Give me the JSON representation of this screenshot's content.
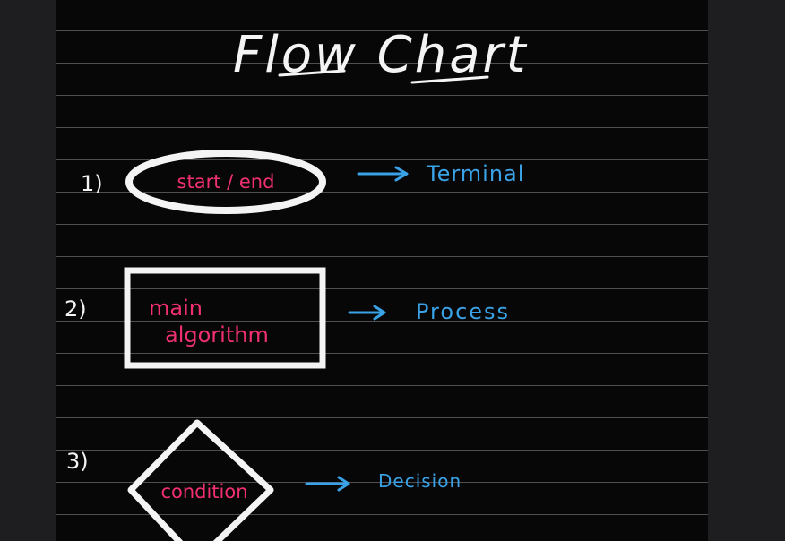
{
  "title": "Flow Chart",
  "colors": {
    "chalk": "#f4f4f4",
    "pink": "#f0306f",
    "blue": "#3aa2e6",
    "paper": "#070708"
  },
  "items": [
    {
      "number": "1)",
      "shape": "ellipse",
      "label": "start / end",
      "name": "Terminal"
    },
    {
      "number": "2)",
      "shape": "rectangle",
      "label_lines": [
        "main",
        "algorithm"
      ],
      "name": "Process"
    },
    {
      "number": "3)",
      "shape": "diamond",
      "label": "condition",
      "name": "Decision"
    }
  ]
}
